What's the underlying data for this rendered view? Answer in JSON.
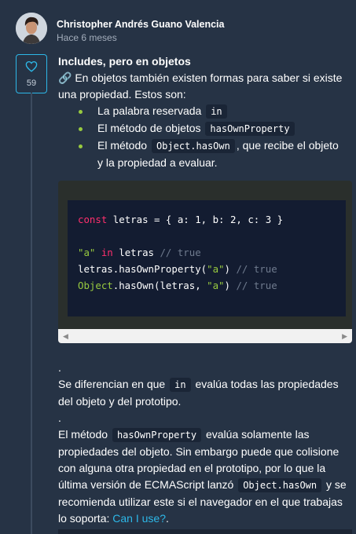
{
  "author": {
    "name": "Christopher Andrés Guano Valencia",
    "time": "Hace 6 meses"
  },
  "likes": {
    "count": "59",
    "icon": "heart-icon"
  },
  "post": {
    "title": "Includes, pero en objetos",
    "intro_icon": "🔗",
    "intro": " En objetos también existen formas para saber si existe una propiedad. Estos son:",
    "bullets": [
      {
        "before": "La palabra reservada ",
        "code": "in",
        "after": ""
      },
      {
        "before": "El método de objetos ",
        "code": "hasOwnProperty",
        "after": ""
      },
      {
        "before": "El método ",
        "code": "Object.hasOwn",
        "after": ", que recibe el objeto y la propiedad a evaluar."
      }
    ],
    "code": {
      "line1_kw": "const",
      "line1_rest": " letras = { a: 1, b: 2, c: 3 }",
      "line3_str": "\"a\"",
      "line3_kw": " in",
      "line3_rest": " letras ",
      "line3_cmt": "// true",
      "line4_a": "letras.hasOwnProperty(",
      "line4_str": "\"a\"",
      "line4_b": ") ",
      "line4_cmt": "// true",
      "line5_a": "Object",
      "line5_b": ".hasOwn(letras, ",
      "line5_str": "\"a\"",
      "line5_c": ") ",
      "line5_cmt": "// true"
    },
    "scroll_left": "◀",
    "scroll_right": "▶",
    "dot1": ".",
    "p1_a": "Se diferencian en que ",
    "p1_code": "in",
    "p1_b": " evalúa todas las propiedades del objeto y del prototipo.",
    "dot2": ".",
    "p2_a": "El método ",
    "p2_code1": "hasOwnProperty",
    "p2_b": " evalúa solamente las propiedades del objeto. Sin embargo puede que colisione con alguna otra propiedad en el prototipo, por lo que la última versión de ECMAScript lanzó ",
    "p2_code2": "Object.hasOwn",
    "p2_c": " y se recomienda utilizar este si el navegador en el que trabajas lo soporta: ",
    "p2_link": "Can I use?",
    "p2_d": "."
  }
}
